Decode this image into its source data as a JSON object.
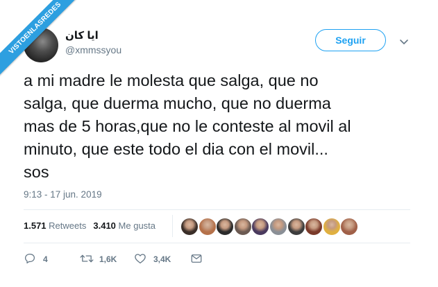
{
  "watermark": {
    "text": "VISTOENLASREDES"
  },
  "tweet": {
    "display_name": "ايا كان",
    "handle": "@xmmssyou",
    "follow_label": "Seguir",
    "text": "a mi madre le molesta que salga, que no\nsalga, que duerma mucho, que no duerma\nmas de 5 horas,que no le conteste al movil al\nminuto, que este todo el dia con el movil...\nsos",
    "timestamp": "9:13 - 17 jun. 2019"
  },
  "stats": {
    "retweets_count": "1.571",
    "retweets_label": "Retweets",
    "likes_count": "3.410",
    "likes_label": "Me gusta"
  },
  "likers": [
    {
      "name": "liker-avatar-1",
      "color": "#3a2e28"
    },
    {
      "name": "liker-avatar-2",
      "color": "#b5714a"
    },
    {
      "name": "liker-avatar-3",
      "color": "#2b2b2b"
    },
    {
      "name": "liker-avatar-4",
      "color": "#6b5a52"
    },
    {
      "name": "liker-avatar-5",
      "color": "#4a3a5e"
    },
    {
      "name": "liker-avatar-6",
      "color": "#8a8f96"
    },
    {
      "name": "liker-avatar-7",
      "color": "#3d3d3d"
    },
    {
      "name": "liker-avatar-8",
      "color": "#7a3a2a"
    },
    {
      "name": "liker-avatar-9",
      "color": "#e0b040"
    },
    {
      "name": "liker-avatar-10",
      "color": "#a06048"
    }
  ],
  "actions": {
    "reply_count": "4",
    "retweet_count": "1,6K",
    "like_count": "3,4K"
  },
  "colors": {
    "accent": "#1da1f2",
    "secondary_text": "#657786",
    "ribbon": "#2d9fe0"
  }
}
